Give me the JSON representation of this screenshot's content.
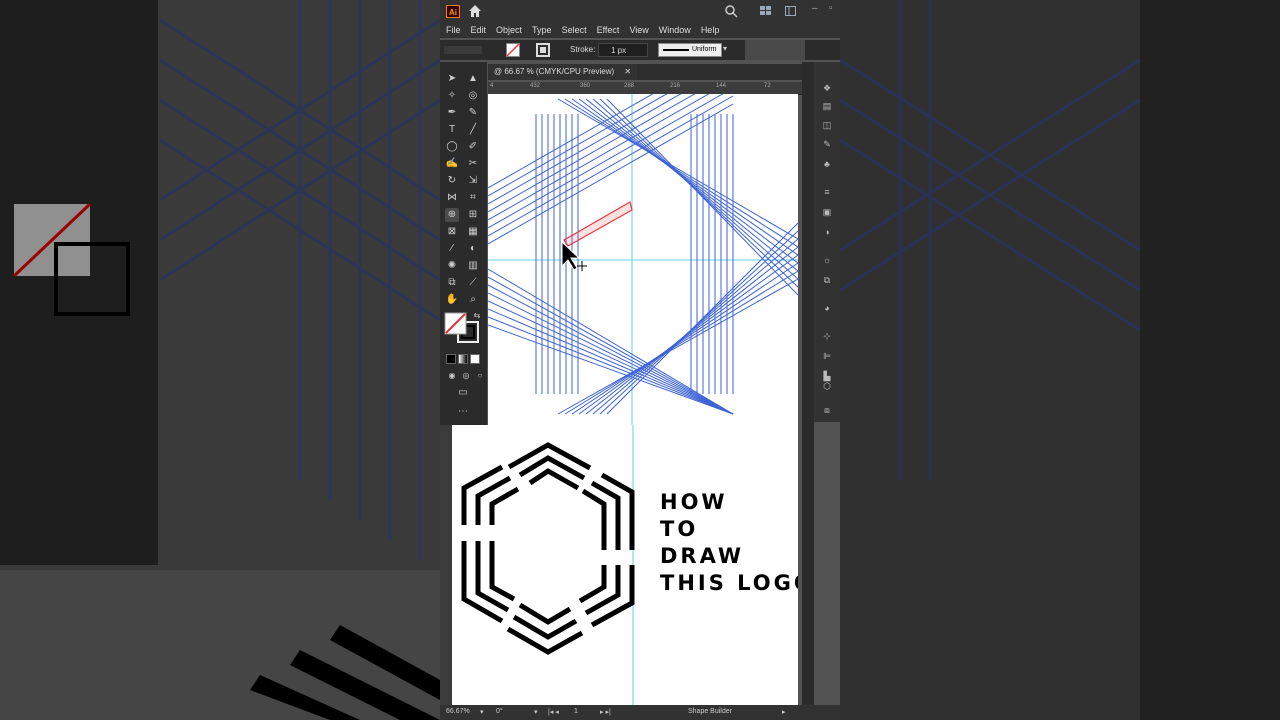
{
  "menu": [
    "File",
    "Edit",
    "Object",
    "Type",
    "Select",
    "Effect",
    "View",
    "Window",
    "Help"
  ],
  "control_bar": {
    "stroke_label": "Stroke:",
    "stroke_weight": "1 px",
    "brush_profile": "Uniform"
  },
  "document_tab": "@ 66.67 % (CMYK/CPU Preview)",
  "ruler_ticks": [
    "4",
    "432",
    "360",
    "288",
    "216",
    "144",
    "72"
  ],
  "logo_title_lines": [
    "HOW",
    "TO",
    "DRAW",
    "THIS LOGO"
  ],
  "status": {
    "zoom": "66.67%",
    "rotation": "0°",
    "artboard_number": "1",
    "active_tool": "Shape Builder"
  },
  "colors": {
    "selection_blue": "#3d63d6",
    "highlight_red": "#e4353a",
    "guide_cyan": "#63d3e6",
    "panel_dark": "#2b2b2b",
    "app_bg": "#535353"
  },
  "icons": {
    "titlebar": [
      "ai-logo",
      "home-icon",
      "search-icon",
      "arrange-documents-icon"
    ],
    "tools": [
      "selection-tool",
      "direct-selection-tool",
      "magic-wand-tool",
      "lasso-tool",
      "pen-tool",
      "curvature-tool",
      "type-tool",
      "line-tool",
      "ellipse-tool",
      "paintbrush-tool",
      "shaper-tool",
      "scissors-tool",
      "rotate-tool",
      "scale-tool",
      "width-tool",
      "free-transform-tool",
      "shape-builder-tool",
      "perspective-tool",
      "mesh-tool",
      "gradient-tool",
      "eyedropper-tool",
      "blend-tool",
      "symbol-sprayer-tool",
      "column-graph-tool",
      "artboard-tool",
      "slice-tool",
      "hand-tool",
      "zoom-tool"
    ]
  }
}
